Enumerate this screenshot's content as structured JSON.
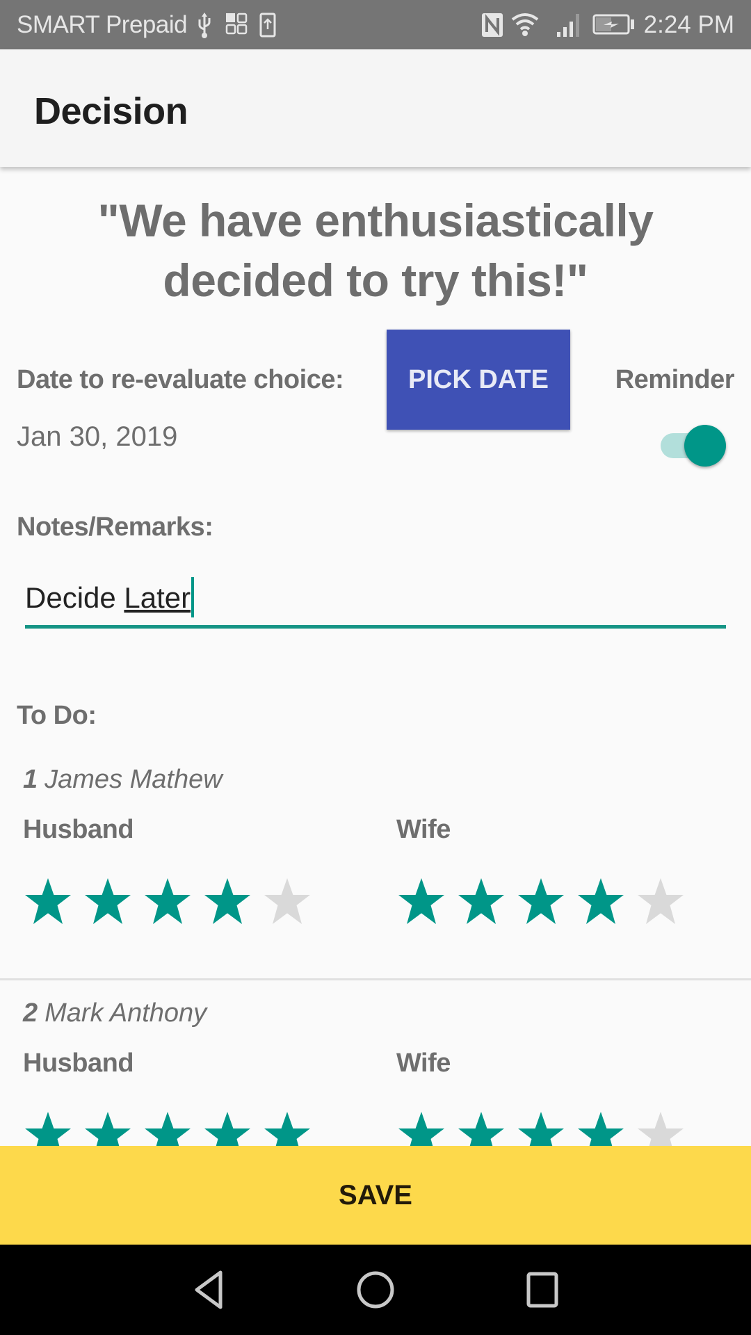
{
  "status_bar": {
    "carrier": "SMART Prepaid",
    "left_icons": [
      "usb-icon",
      "app-grid-icon",
      "upload-icon"
    ],
    "right_icons": [
      "nfc-icon",
      "wifi-icon",
      "signal-icon",
      "battery-charging-icon"
    ],
    "time": "2:24 PM"
  },
  "app_bar": {
    "title": "Decision"
  },
  "decision": {
    "quote": "\"We have enthusiastically decided to try this!\""
  },
  "reevaluate": {
    "label": "Date to re-evaluate choice:",
    "pick_date_label": "PICK DATE",
    "date_value": "Jan 30, 2019",
    "reminder_label": "Reminder",
    "reminder_on": true
  },
  "notes": {
    "label": "Notes/Remarks:",
    "value_part1": "Decide ",
    "value_part2": "Later"
  },
  "todo": {
    "label": "To Do:",
    "items": [
      {
        "number": "1",
        "name": "James Mathew",
        "husband_label": "Husband",
        "wife_label": "Wife",
        "husband_rating": 4,
        "wife_rating": 4,
        "max_rating": 5
      },
      {
        "number": "2",
        "name": "Mark Anthony",
        "husband_label": "Husband",
        "wife_label": "Wife",
        "husband_rating": 5,
        "wife_rating": 4,
        "max_rating": 5
      }
    ]
  },
  "save_label": "SAVE",
  "colors": {
    "accent": "#009688",
    "primary_button": "#3f51b5",
    "save_button": "#fdd94b",
    "star_empty": "#d9d9d9"
  },
  "nav_bar": {
    "buttons": [
      "back-icon",
      "home-icon",
      "recents-icon"
    ]
  }
}
